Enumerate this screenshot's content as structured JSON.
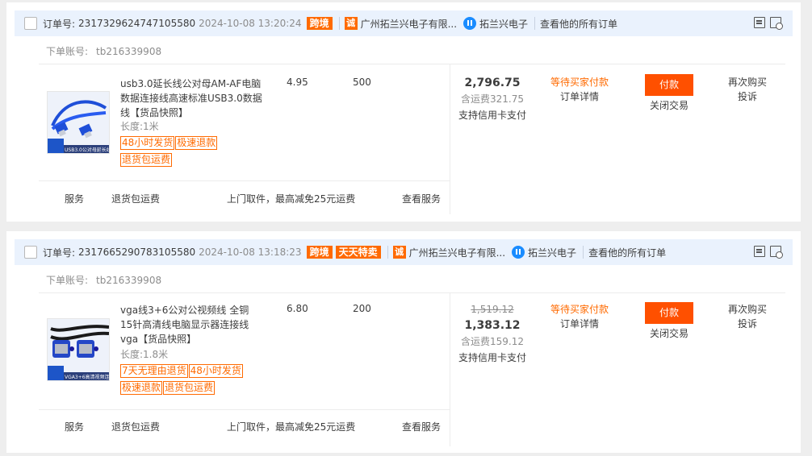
{
  "orders": [
    {
      "order_label": "订单号:",
      "order_number": "2317329624747105580",
      "time": "2024-10-08 13:20:24",
      "tags": [
        "跨境"
      ],
      "shop_badge": "诚",
      "shop_name": "广州拓兰兴电子有限...",
      "wangwang_name": "拓兰兴电子",
      "all_orders_link": "查看他的所有订单",
      "account_label": "下单账号:",
      "account_value": "tb216339908",
      "product": {
        "title": "usb3.0延长线公对母AM-AF电脑数据连接线高速标准USB3.0数据线",
        "snapshot": "【货品快照】",
        "spec": "长度:1米",
        "tags": [
          "48小时发货",
          "极速退款",
          "退货包运费"
        ],
        "thumb_caption": "USB3.0公对母延长线",
        "price": "4.95",
        "quantity": "500"
      },
      "original_price": "",
      "total": "2,796.75",
      "shipping": "含运费321.75",
      "credit": "支持信用卡支付",
      "status": "等待买家付款",
      "detail_link": "订单详情",
      "pay_button": "付款",
      "close_link": "关闭交易",
      "rebuy_link": "再次购买",
      "complain_link": "投诉",
      "service_label": "服务",
      "service_type": "退货包运费",
      "service_desc": "上门取件，最高减免25元运费",
      "service_link": "查看服务"
    },
    {
      "order_label": "订单号:",
      "order_number": "2317665290783105580",
      "time": "2024-10-08 13:18:23",
      "tags": [
        "跨境",
        "天天特卖"
      ],
      "shop_badge": "诚",
      "shop_name": "广州拓兰兴电子有限...",
      "wangwang_name": "拓兰兴电子",
      "all_orders_link": "查看他的所有订单",
      "account_label": "下单账号:",
      "account_value": "tb216339908",
      "product": {
        "title": "vga线3+6公对公视频线 全铜15针高清线电脑显示器连接线vga",
        "snapshot": "【货品快照】",
        "spec": "长度:1.8米",
        "tags": [
          "7天无理由退货",
          "48小时发货",
          "极速退款",
          "退货包运费"
        ],
        "thumb_caption": "VGA3+6高清视频连接线",
        "price": "6.80",
        "quantity": "200"
      },
      "original_price": "1,519.12",
      "total": "1,383.12",
      "shipping": "含运费159.12",
      "credit": "支持信用卡支付",
      "status": "等待买家付款",
      "detail_link": "订单详情",
      "pay_button": "付款",
      "close_link": "关闭交易",
      "rebuy_link": "再次购买",
      "complain_link": "投诉",
      "service_label": "服务",
      "service_type": "退货包运费",
      "service_desc": "上门取件，最高减免25元运费",
      "service_link": "查看服务"
    }
  ],
  "colors": {
    "accent": "#ff6a00",
    "pay_button": "#ff5000",
    "header_bg": "#eaf2fd",
    "wangwang": "#1a8cff"
  }
}
